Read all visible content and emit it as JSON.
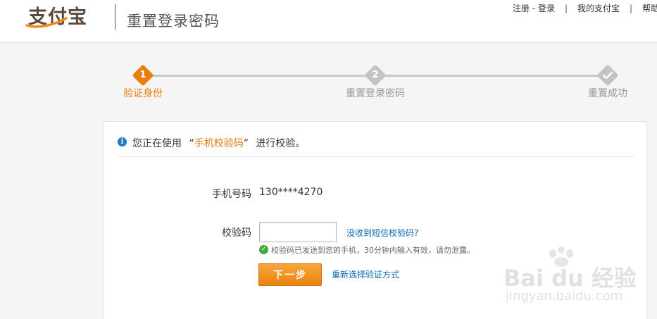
{
  "header": {
    "logo_text": "支付宝",
    "page_title": "重置登录密码",
    "links": [
      {
        "label": "注册 - 登录"
      },
      {
        "label": "我的支付宝"
      },
      {
        "label": "帮助"
      }
    ]
  },
  "steps": [
    {
      "number": "1",
      "label": "验证身份",
      "state": "active"
    },
    {
      "number": "2",
      "label": "重置登录密码",
      "state": "pending"
    },
    {
      "number": "",
      "icon": "check-icon",
      "label": "重置成功",
      "state": "pending"
    }
  ],
  "colors": {
    "accent": "#e87e0f",
    "step_pending": "#c3c3c3",
    "link": "#0a69b5",
    "success": "#42a842",
    "info": "#1f78c8"
  },
  "notice": {
    "prefix": "您正在使用",
    "open_quote": "“",
    "method": "手机校验码",
    "close_quote": "”",
    "suffix": "进行校验。"
  },
  "form": {
    "phone_label": "手机号码",
    "phone_value": "130****4270",
    "code_label": "校验码",
    "code_value": "",
    "code_placeholder": "",
    "no_sms_link": "没收到短信校验码?",
    "hint": "校验码已发送到您的手机，30分钟内输入有效，请勿泄露。",
    "next_button": "下一步",
    "reselect_link": "重新选择验证方式"
  },
  "watermark": {
    "logo": "Bai du 经验",
    "url": "jingyan.baidu.com"
  }
}
